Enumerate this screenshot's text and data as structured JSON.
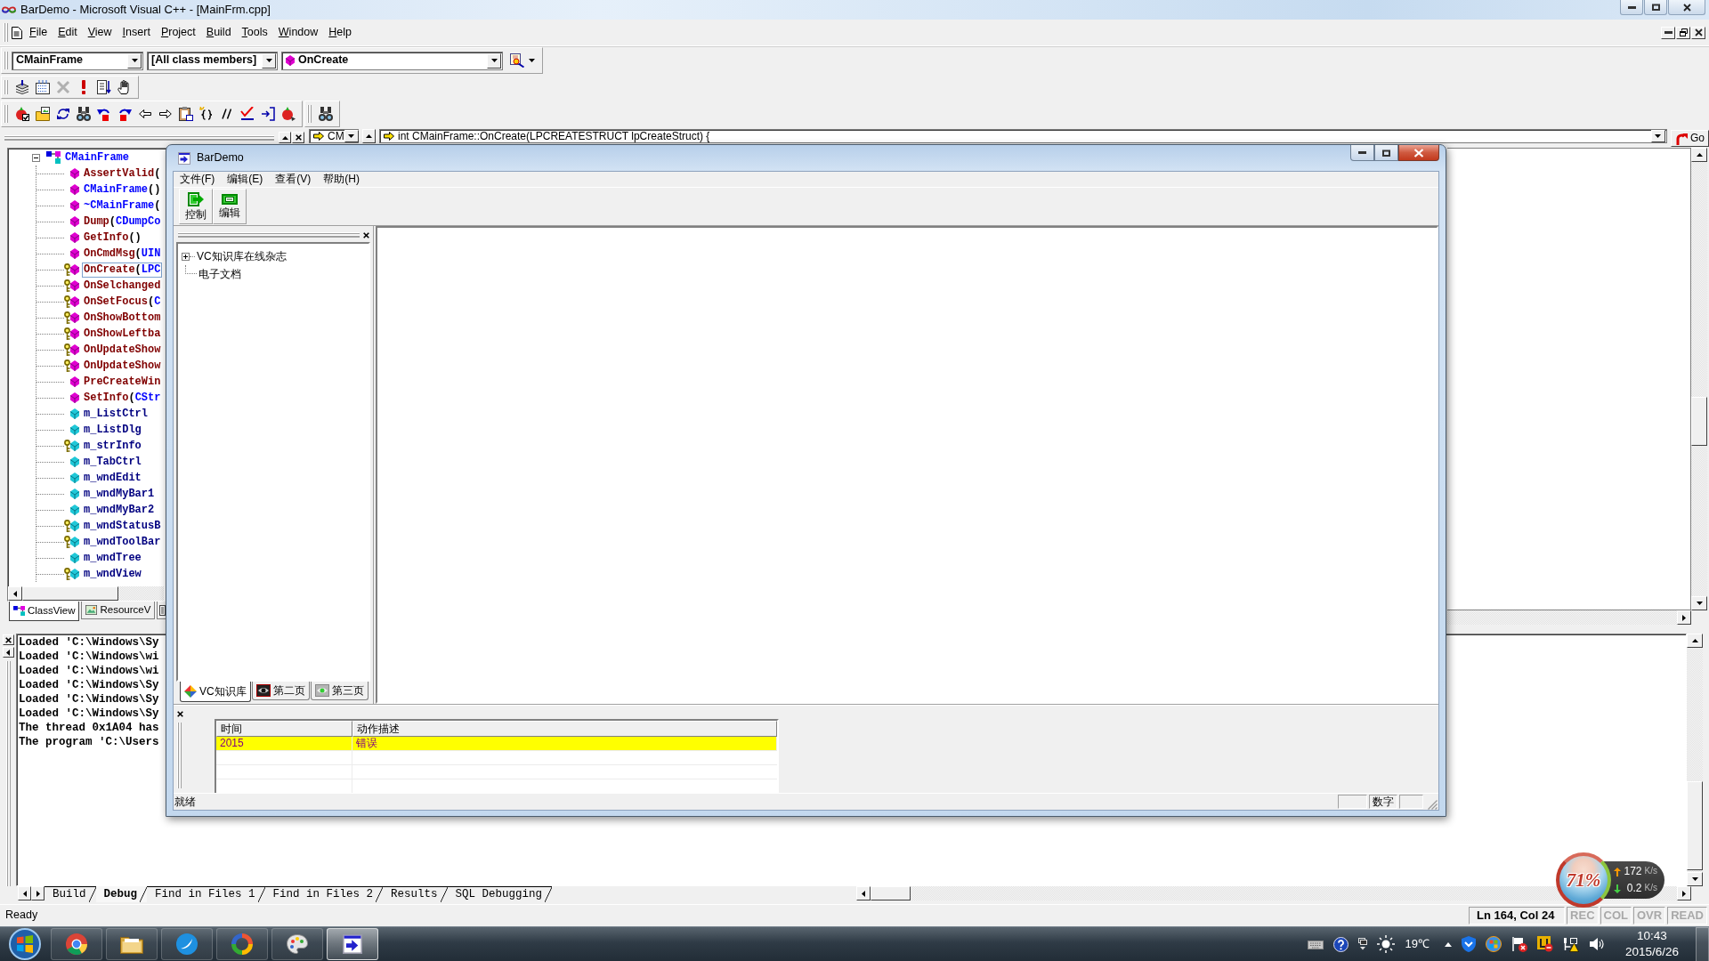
{
  "window": {
    "title": "BarDemo - Microsoft Visual C++ - [MainFrm.cpp]"
  },
  "menu": [
    "File",
    "Edit",
    "View",
    "Insert",
    "Project",
    "Build",
    "Tools",
    "Window",
    "Help"
  ],
  "wizard_bar": {
    "class": "CMainFrame",
    "filter": "[All class members]",
    "member": "OnCreate"
  },
  "workspace": {
    "tree": [
      {
        "kind": "class",
        "expanded": true,
        "selected": false,
        "parts": [
          {
            "text": "CMainFrame",
            "kind": "type"
          }
        ],
        "children": [
          {
            "kind": "method",
            "protected": false,
            "selected": false,
            "parts": [
              {
                "text": "AssertValid",
                "kind": "name"
              },
              {
                "text": "(",
                "kind": "punct"
              }
            ]
          },
          {
            "kind": "method",
            "protected": false,
            "selected": false,
            "parts": [
              {
                "text": "CMainFrame",
                "kind": "type"
              },
              {
                "text": "()",
                "kind": "punct"
              }
            ]
          },
          {
            "kind": "method",
            "protected": false,
            "selected": false,
            "parts": [
              {
                "text": "~CMainFrame",
                "kind": "type"
              },
              {
                "text": "(",
                "kind": "punct"
              }
            ]
          },
          {
            "kind": "method",
            "protected": false,
            "selected": false,
            "parts": [
              {
                "text": "Dump",
                "kind": "name"
              },
              {
                "text": "(",
                "kind": "punct"
              },
              {
                "text": "CDumpCo",
                "kind": "type"
              }
            ]
          },
          {
            "kind": "method",
            "protected": false,
            "selected": false,
            "parts": [
              {
                "text": "GetInfo",
                "kind": "name"
              },
              {
                "text": "()",
                "kind": "punct"
              }
            ]
          },
          {
            "kind": "method",
            "protected": false,
            "selected": false,
            "parts": [
              {
                "text": "OnCmdMsg",
                "kind": "name"
              },
              {
                "text": "(",
                "kind": "punct"
              },
              {
                "text": "UIN",
                "kind": "type"
              }
            ]
          },
          {
            "kind": "method",
            "protected": true,
            "selected": true,
            "parts": [
              {
                "text": "OnCreate",
                "kind": "name"
              },
              {
                "text": "(",
                "kind": "punct"
              },
              {
                "text": "LPC",
                "kind": "type"
              }
            ]
          },
          {
            "kind": "method",
            "protected": true,
            "selected": false,
            "parts": [
              {
                "text": "OnSelchanged",
                "kind": "name"
              }
            ]
          },
          {
            "kind": "method",
            "protected": true,
            "selected": false,
            "parts": [
              {
                "text": "OnSetFocus",
                "kind": "name"
              },
              {
                "text": "(",
                "kind": "punct"
              },
              {
                "text": "C",
                "kind": "type"
              }
            ]
          },
          {
            "kind": "method",
            "protected": true,
            "selected": false,
            "parts": [
              {
                "text": "OnShowBottom",
                "kind": "name"
              }
            ]
          },
          {
            "kind": "method",
            "protected": true,
            "selected": false,
            "parts": [
              {
                "text": "OnShowLeftba",
                "kind": "name"
              }
            ]
          },
          {
            "kind": "method",
            "protected": true,
            "selected": false,
            "parts": [
              {
                "text": "OnUpdateShow",
                "kind": "name"
              }
            ]
          },
          {
            "kind": "method",
            "protected": true,
            "selected": false,
            "parts": [
              {
                "text": "OnUpdateShow",
                "kind": "name"
              }
            ]
          },
          {
            "kind": "method",
            "protected": false,
            "selected": false,
            "parts": [
              {
                "text": "PreCreateWin",
                "kind": "name"
              }
            ]
          },
          {
            "kind": "method",
            "protected": false,
            "selected": false,
            "parts": [
              {
                "text": "SetInfo",
                "kind": "name"
              },
              {
                "text": "(",
                "kind": "punct"
              },
              {
                "text": "CStr",
                "kind": "type"
              }
            ]
          },
          {
            "kind": "variable",
            "protected": false,
            "selected": false,
            "parts": [
              {
                "text": "m_ListCtrl",
                "kind": "member"
              }
            ]
          },
          {
            "kind": "variable",
            "protected": false,
            "selected": false,
            "parts": [
              {
                "text": "m_ListDlg",
                "kind": "member"
              }
            ]
          },
          {
            "kind": "variable",
            "protected": true,
            "selected": false,
            "parts": [
              {
                "text": "m_strInfo",
                "kind": "member"
              }
            ]
          },
          {
            "kind": "variable",
            "protected": false,
            "selected": false,
            "parts": [
              {
                "text": "m_TabCtrl",
                "kind": "member"
              }
            ]
          },
          {
            "kind": "variable",
            "protected": false,
            "selected": false,
            "parts": [
              {
                "text": "m_wndEdit",
                "kind": "member"
              }
            ]
          },
          {
            "kind": "variable",
            "protected": false,
            "selected": false,
            "parts": [
              {
                "text": "m_wndMyBar1",
                "kind": "member"
              }
            ]
          },
          {
            "kind": "variable",
            "protected": false,
            "selected": false,
            "parts": [
              {
                "text": "m_wndMyBar2",
                "kind": "member"
              }
            ]
          },
          {
            "kind": "variable",
            "protected": true,
            "selected": false,
            "parts": [
              {
                "text": "m_wndStatusB",
                "kind": "member"
              }
            ]
          },
          {
            "kind": "variable",
            "protected": true,
            "selected": false,
            "parts": [
              {
                "text": "m_wndToolBar",
                "kind": "member"
              }
            ]
          },
          {
            "kind": "variable",
            "protected": false,
            "selected": false,
            "parts": [
              {
                "text": "m_wndTree",
                "kind": "member"
              }
            ]
          },
          {
            "kind": "variable",
            "protected": true,
            "selected": false,
            "parts": [
              {
                "text": "m_wndView",
                "kind": "member"
              }
            ]
          }
        ]
      }
    ],
    "tabs": [
      {
        "label": "ClassView",
        "kind": "class",
        "selected": true
      },
      {
        "label": "ResourceV",
        "kind": "resource",
        "selected": false
      },
      {
        "kind": "file",
        "selected": false
      }
    ]
  },
  "editor": {
    "scope": "CM",
    "function": "int CMainFrame::OnCreate(LPCREATESTRUCT lpCreateStruct) {",
    "go_label": "Go"
  },
  "output": {
    "lines": [
      "Loaded 'C:\\Windows\\Sy",
      "Loaded 'C:\\Windows\\wi",
      "Loaded 'C:\\Windows\\wi",
      "Loaded 'C:\\Windows\\Sy",
      "Loaded 'C:\\Windows\\Sy",
      "Loaded 'C:\\Windows\\Sy",
      "The thread 0x1A04 has",
      "The program 'C:\\Users"
    ],
    "tabs": [
      {
        "label": "Build",
        "selected": false
      },
      {
        "label": "Debug",
        "selected": true
      },
      {
        "label": "Find in Files 1",
        "selected": false
      },
      {
        "label": "Find in Files 2",
        "selected": false
      },
      {
        "label": "Results",
        "selected": false
      },
      {
        "label": "SQL Debugging",
        "selected": false
      }
    ]
  },
  "status_bar": {
    "message": "Ready",
    "position": "Ln 164, Col 24",
    "indicators": [
      {
        "label": "REC",
        "on": false
      },
      {
        "label": "COL",
        "on": false
      },
      {
        "label": "OVR",
        "on": false
      },
      {
        "label": "READ",
        "on": false
      }
    ]
  },
  "app_window": {
    "title": "BarDemo",
    "menu": [
      "文件(F)",
      "编辑(E)",
      "查看(V)",
      "帮助(H)"
    ],
    "toolbar": [
      {
        "label": "控制",
        "kind": "door"
      },
      {
        "label": "编辑",
        "kind": "panel"
      }
    ],
    "tree": [
      {
        "label": "VC知识库在线杂志",
        "expanded": false
      },
      {
        "label": "电子文档"
      }
    ],
    "tabs": [
      {
        "label": "VC知识库",
        "kind": "logo",
        "selected": true
      },
      {
        "label": "第二页",
        "kind": "mask",
        "selected": false
      },
      {
        "label": "第三页",
        "kind": "eye",
        "selected": false
      }
    ],
    "log_table": {
      "columns": [
        "时间",
        "动作描述"
      ],
      "rows": [
        {
          "cells": [
            "2015",
            "错误"
          ],
          "highlighted": true
        }
      ]
    },
    "status_bar": {
      "message": "就绪",
      "indicator": "数字"
    }
  },
  "net_monitor": {
    "usage": "71%",
    "upload": {
      "value": "172",
      "unit": "K/s"
    },
    "download": {
      "value": "0.2",
      "unit": "K/s"
    }
  },
  "taskbar": {
    "apps": [
      {
        "kind": "browser",
        "selected": false
      },
      {
        "kind": "folder",
        "selected": false
      },
      {
        "kind": "bubble",
        "selected": false
      },
      {
        "kind": "ring",
        "selected": false
      },
      {
        "kind": "palette",
        "selected": false
      },
      {
        "kind": "arrow",
        "selected": true
      }
    ],
    "tray": {
      "weather": "19℃",
      "time": "10:43",
      "date": "2015/6/26"
    }
  }
}
